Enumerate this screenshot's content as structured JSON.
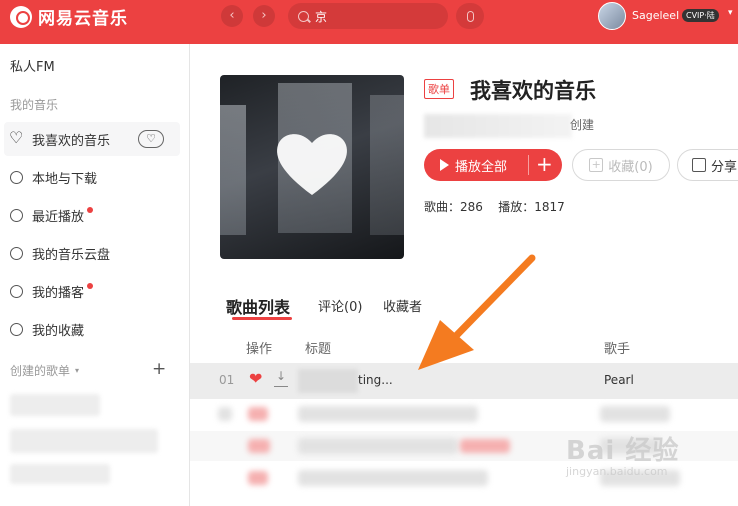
{
  "app": {
    "name": "网易云音乐"
  },
  "colors": {
    "accent": "#ec4141",
    "topbar": "#ec4141",
    "arrow": "#f47b20"
  },
  "topbar": {
    "back_icon": "chevron-left-icon",
    "forward_icon": "chevron-right-icon",
    "search_value": "京",
    "mic_icon": "mic-icon",
    "user": {
      "name": "Sageleel",
      "vip": "CVIP·陆"
    }
  },
  "sidebar": {
    "fm": "私人FM",
    "section_my_music": "我的音乐",
    "items": [
      {
        "label": "我喜欢的音乐",
        "icon": "heart-icon",
        "active": true
      },
      {
        "label": "本地与下载",
        "icon": "download-icon",
        "active": false
      },
      {
        "label": "最近播放",
        "icon": "clock-icon",
        "active": false,
        "dot": true
      },
      {
        "label": "我的音乐云盘",
        "icon": "cloud-icon",
        "active": false
      },
      {
        "label": "我的播客",
        "icon": "podcast-icon",
        "active": false,
        "dot": true
      },
      {
        "label": "我的收藏",
        "icon": "user-collect-icon",
        "active": false
      }
    ],
    "section_created": "创建的歌单",
    "add_symbol": "+"
  },
  "playlist": {
    "tag": "歌单",
    "title": "我喜欢的音乐",
    "created_suffix": "创建",
    "play_all_label": "播放全部",
    "add_symbol": "+",
    "collect_label": "收藏(0)",
    "share_label": "分享",
    "stats": {
      "songs_label": "歌曲：",
      "songs_value": "286",
      "plays_label": "播放：",
      "plays_value": "1817"
    }
  },
  "tabs": [
    {
      "label": "歌曲列表",
      "active": true
    },
    {
      "label": "评论(0)",
      "active": false
    },
    {
      "label": "收藏者",
      "active": false
    }
  ],
  "table": {
    "headers": {
      "ops": "操作",
      "title": "标题",
      "artist": "歌手"
    },
    "rows": [
      {
        "num": "01",
        "title": "ting...",
        "artist": "Pearl"
      }
    ]
  },
  "watermark": {
    "main": "Bai 经验",
    "sub": "jingyan.baidu.com"
  }
}
